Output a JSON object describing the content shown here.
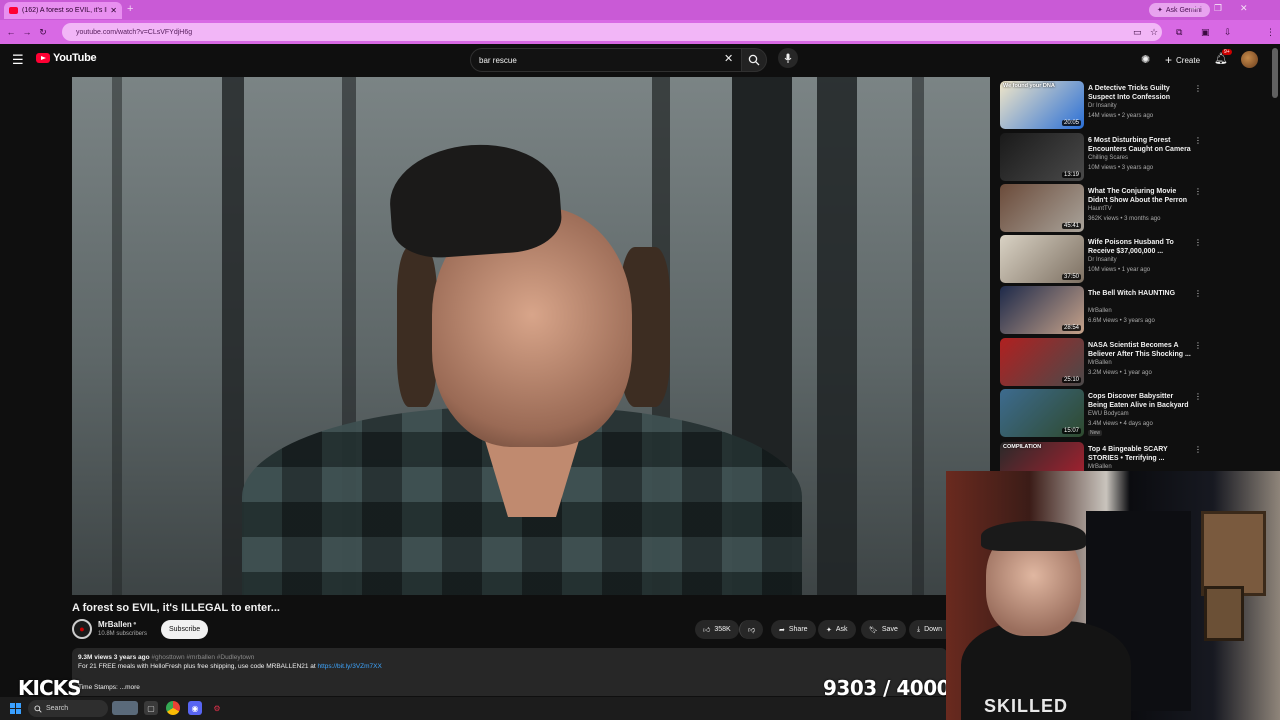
{
  "browser": {
    "tab_title": "(162) A forest so EVIL, it's ILLE...",
    "tab_close": "✕",
    "new_tab": "+",
    "ask_gemini": "Ask Gemini",
    "url": "youtube.com/watch?v=CLsVFYdjH6g"
  },
  "header": {
    "logo_text": "YouTube",
    "search_value": "bar rescue",
    "create_label": "Create",
    "notifications_badge": "9+"
  },
  "video": {
    "title": "A forest so EVIL, it's ILLEGAL to enter...",
    "channel_name": "MrBallen",
    "channel_subs": "10.8M subscribers",
    "subscribe_label": "Subscribe",
    "like_count": "358K",
    "share_label": "Share",
    "ask_label": "Ask",
    "save_label": "Save",
    "download_label": "Down",
    "views_date": "9.3M views  3 years ago",
    "tags": "#ghosttown #mrballen #Dudleytown",
    "description_line": "For 21 FREE meals with HelloFresh plus free shipping, use code MRBALLEN21 at ",
    "description_link": "https://bit.ly/3VZm7XX",
    "timestamps_label": "Time Stamps: ...more"
  },
  "overlay": {
    "kicks_label": "KICKS",
    "counter": "9303 / 40000"
  },
  "recommendations": [
    {
      "title": "A Detective Tricks Guilty Suspect Into Confession",
      "channel": "Dr Insanity",
      "meta": "14M views • 2 years ago",
      "duration": "20:05",
      "thumb_text": "We found your DNA"
    },
    {
      "title": "6 Most Disturbing Forest Encounters Caught on Camera",
      "channel": "Chilling Scares",
      "meta": "10M views • 3 years ago",
      "duration": "13:19"
    },
    {
      "title": "What The Conjuring Movie Didn't Show About the Perron ...",
      "channel": "HauntTV",
      "meta": "362K views • 3 months ago",
      "duration": "45:41"
    },
    {
      "title": "Wife Poisons Husband To Receive $37,000,000 ...",
      "channel": "Dr Insanity",
      "meta": "10M views • 1 year ago",
      "duration": "37:50"
    },
    {
      "title": "The Bell Witch HAUNTING",
      "channel": "MrBallen",
      "meta": "6.6M views • 3 years ago",
      "duration": "28:54"
    },
    {
      "title": "NASA Scientist Becomes A Believer After This Shocking ...",
      "channel": "MrBallen",
      "meta": "3.2M views • 1 year ago",
      "duration": "25:10"
    },
    {
      "title": "Cops Discover Babysitter Being Eaten Alive in Backyard",
      "channel": "EWU Bodycam",
      "meta": "3.4M views • 4 days ago",
      "duration": "15:07",
      "badge": "New"
    },
    {
      "title": "Top 4 Bingeable SCARY STORIES • Terrifying ...",
      "channel": "MrBallen",
      "meta": "",
      "duration": "",
      "thumb_text": "COMPILATION"
    }
  ],
  "webcam": {
    "shirt_text": "SKILLED"
  },
  "taskbar": {
    "search_label": "Search"
  },
  "colors": {
    "accent_red": "#ff0033",
    "browser_frame": "#d869e4",
    "link_blue": "#3ea6ff"
  }
}
